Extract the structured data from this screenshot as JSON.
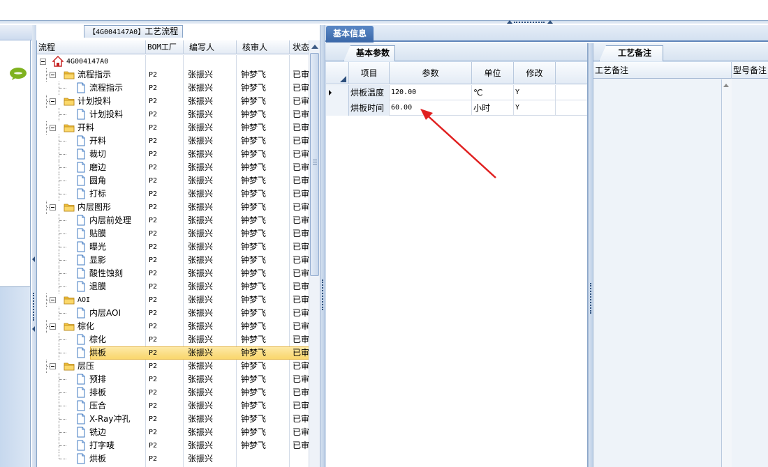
{
  "tree_panel": {
    "title": "【4G004147A0】工艺流程",
    "title_code": "【4G004147A0】",
    "title_text": "工艺流程",
    "columns": [
      "流程",
      "BOM工厂",
      "编写人",
      "核审人",
      "状态"
    ],
    "rows": [
      {
        "level": 0,
        "name": "4G004147A0",
        "type": "root",
        "bom": "",
        "writer": "",
        "reviewer": "",
        "status": ""
      },
      {
        "level": 1,
        "name": "流程指示",
        "type": "folder",
        "bom": "P2",
        "writer": "张振兴",
        "reviewer": "钟梦飞",
        "status": "已审"
      },
      {
        "level": 2,
        "name": "流程指示",
        "type": "doc",
        "bom": "P2",
        "writer": "张振兴",
        "reviewer": "钟梦飞",
        "status": "已审"
      },
      {
        "level": 1,
        "name": "计划投料",
        "type": "folder",
        "bom": "P2",
        "writer": "张振兴",
        "reviewer": "钟梦飞",
        "status": "已审"
      },
      {
        "level": 2,
        "name": "计划投料",
        "type": "doc",
        "bom": "P2",
        "writer": "张振兴",
        "reviewer": "钟梦飞",
        "status": "已审"
      },
      {
        "level": 1,
        "name": "开料",
        "type": "folder",
        "bom": "P2",
        "writer": "张振兴",
        "reviewer": "钟梦飞",
        "status": "已审"
      },
      {
        "level": 2,
        "name": "开料",
        "type": "doc",
        "bom": "P2",
        "writer": "张振兴",
        "reviewer": "钟梦飞",
        "status": "已审"
      },
      {
        "level": 2,
        "name": "裁切",
        "type": "doc",
        "bom": "P2",
        "writer": "张振兴",
        "reviewer": "钟梦飞",
        "status": "已审"
      },
      {
        "level": 2,
        "name": "磨边",
        "type": "doc",
        "bom": "P2",
        "writer": "张振兴",
        "reviewer": "钟梦飞",
        "status": "已审"
      },
      {
        "level": 2,
        "name": "圆角",
        "type": "doc",
        "bom": "P2",
        "writer": "张振兴",
        "reviewer": "钟梦飞",
        "status": "已审"
      },
      {
        "level": 2,
        "name": "打标",
        "type": "doc",
        "bom": "P2",
        "writer": "张振兴",
        "reviewer": "钟梦飞",
        "status": "已审"
      },
      {
        "level": 1,
        "name": "内层图形",
        "type": "folder",
        "bom": "P2",
        "writer": "张振兴",
        "reviewer": "钟梦飞",
        "status": "已审"
      },
      {
        "level": 2,
        "name": "内层前处理",
        "type": "doc",
        "bom": "P2",
        "writer": "张振兴",
        "reviewer": "钟梦飞",
        "status": "已审"
      },
      {
        "level": 2,
        "name": "贴膜",
        "type": "doc",
        "bom": "P2",
        "writer": "张振兴",
        "reviewer": "钟梦飞",
        "status": "已审"
      },
      {
        "level": 2,
        "name": "曝光",
        "type": "doc",
        "bom": "P2",
        "writer": "张振兴",
        "reviewer": "钟梦飞",
        "status": "已审"
      },
      {
        "level": 2,
        "name": "显影",
        "type": "doc",
        "bom": "P2",
        "writer": "张振兴",
        "reviewer": "钟梦飞",
        "status": "已审"
      },
      {
        "level": 2,
        "name": "酸性蚀刻",
        "type": "doc",
        "bom": "P2",
        "writer": "张振兴",
        "reviewer": "钟梦飞",
        "status": "已审"
      },
      {
        "level": 2,
        "name": "退膜",
        "type": "doc",
        "bom": "P2",
        "writer": "张振兴",
        "reviewer": "钟梦飞",
        "status": "已审"
      },
      {
        "level": 1,
        "name": "AOI",
        "type": "folder",
        "bom": "P2",
        "writer": "张振兴",
        "reviewer": "钟梦飞",
        "status": "已审"
      },
      {
        "level": 2,
        "name": "内层AOI",
        "type": "doc",
        "bom": "P2",
        "writer": "张振兴",
        "reviewer": "钟梦飞",
        "status": "已审"
      },
      {
        "level": 1,
        "name": "棕化",
        "type": "folder",
        "bom": "P2",
        "writer": "张振兴",
        "reviewer": "钟梦飞",
        "status": "已审"
      },
      {
        "level": 2,
        "name": "棕化",
        "type": "doc",
        "bom": "P2",
        "writer": "张振兴",
        "reviewer": "钟梦飞",
        "status": "已审"
      },
      {
        "level": 2,
        "name": "烘板",
        "type": "doc",
        "bom": "P2",
        "writer": "张振兴",
        "reviewer": "钟梦飞",
        "status": "已审",
        "selected": true
      },
      {
        "level": 1,
        "name": "层压",
        "type": "folder",
        "bom": "P2",
        "writer": "张振兴",
        "reviewer": "钟梦飞",
        "status": "已审"
      },
      {
        "level": 2,
        "name": "预排",
        "type": "doc",
        "bom": "P2",
        "writer": "张振兴",
        "reviewer": "钟梦飞",
        "status": "已审"
      },
      {
        "level": 2,
        "name": "排板",
        "type": "doc",
        "bom": "P2",
        "writer": "张振兴",
        "reviewer": "钟梦飞",
        "status": "已审"
      },
      {
        "level": 2,
        "name": "压合",
        "type": "doc",
        "bom": "P2",
        "writer": "张振兴",
        "reviewer": "钟梦飞",
        "status": "已审"
      },
      {
        "level": 2,
        "name": "X-Ray冲孔",
        "type": "doc",
        "bom": "P2",
        "writer": "张振兴",
        "reviewer": "钟梦飞",
        "status": "已审"
      },
      {
        "level": 2,
        "name": "铣边",
        "type": "doc",
        "bom": "P2",
        "writer": "张振兴",
        "reviewer": "钟梦飞",
        "status": "已审"
      },
      {
        "level": 2,
        "name": "打字唛",
        "type": "doc",
        "bom": "P2",
        "writer": "张振兴",
        "reviewer": "钟梦飞",
        "status": "已审"
      },
      {
        "level": 2,
        "name": "烘板",
        "type": "doc",
        "bom": "P2",
        "writer": "张振兴",
        "reviewer": "",
        "status": ""
      }
    ]
  },
  "right_panel": {
    "outer_tab": "基本信息",
    "params_tab": "基本参数",
    "params_columns": [
      "项目",
      "参数",
      "单位",
      "修改"
    ],
    "params_rows": [
      {
        "item": "烘板温度",
        "value": "120.00",
        "unit": "℃",
        "modify": "Y",
        "current": true
      },
      {
        "item": "烘板时间",
        "value": "60.00",
        "unit": "小时",
        "modify": "Y",
        "current": false
      }
    ],
    "remark_tab": "工艺备注",
    "remark_columns": [
      "工艺备注",
      "型号备注"
    ]
  },
  "colors": {
    "selected_row": "#f9d66c",
    "tab_active": "#3a67a8",
    "annotation_arrow": "#e02020"
  },
  "icons": [
    "chat-bubble-icon",
    "home-icon",
    "folder-icon",
    "document-icon"
  ]
}
